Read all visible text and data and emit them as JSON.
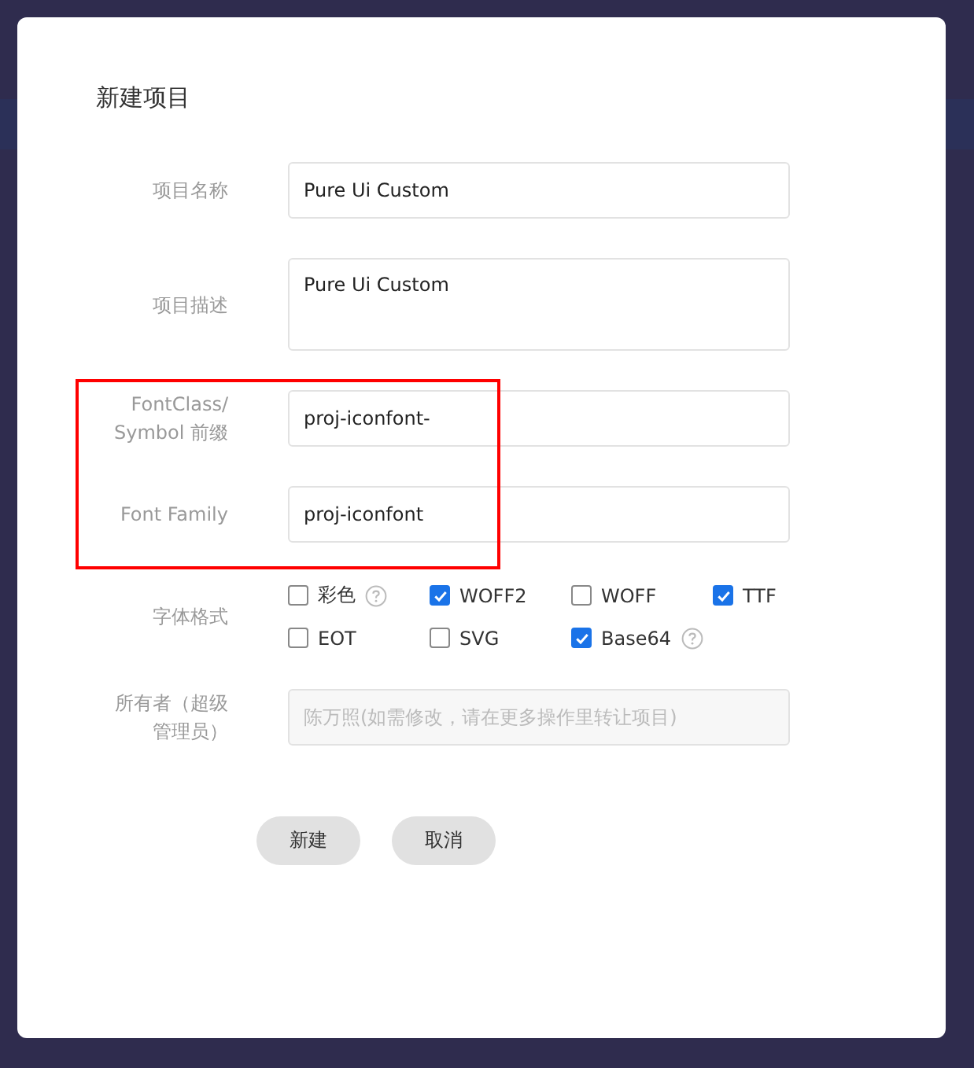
{
  "dialog": {
    "title": "新建项目",
    "fields": [
      {
        "kind": "input",
        "label": "项目名称",
        "value": "Pure Ui Custom",
        "highlighted": false
      },
      {
        "kind": "textarea",
        "label": "项目描述",
        "value": "Pure Ui Custom",
        "highlighted": false
      },
      {
        "kind": "input",
        "label": "FontClass/\nSymbol 前缀",
        "value": "proj-iconfont-",
        "highlighted": true
      },
      {
        "kind": "input",
        "label": "Font Family",
        "value": "proj-iconfont",
        "highlighted": true
      },
      {
        "kind": "checkboxes",
        "label": "字体格式",
        "highlighted": false,
        "options": [
          {
            "label": "彩色",
            "checked": false,
            "help": true
          },
          {
            "label": "WOFF2",
            "checked": true,
            "help": false
          },
          {
            "label": "WOFF",
            "checked": false,
            "help": false
          },
          {
            "label": "TTF",
            "checked": true,
            "help": false
          },
          {
            "label": "EOT",
            "checked": false,
            "help": false
          },
          {
            "label": "SVG",
            "checked": false,
            "help": false
          },
          {
            "label": "Base64",
            "checked": true,
            "help": true
          }
        ]
      },
      {
        "kind": "disabled",
        "label": "所有者（超级管理员）",
        "highlighted": false,
        "placeholder": "陈万照(如需修改，请在更多操作里转让项目)"
      }
    ],
    "buttons": [
      "新建",
      "取消"
    ]
  }
}
